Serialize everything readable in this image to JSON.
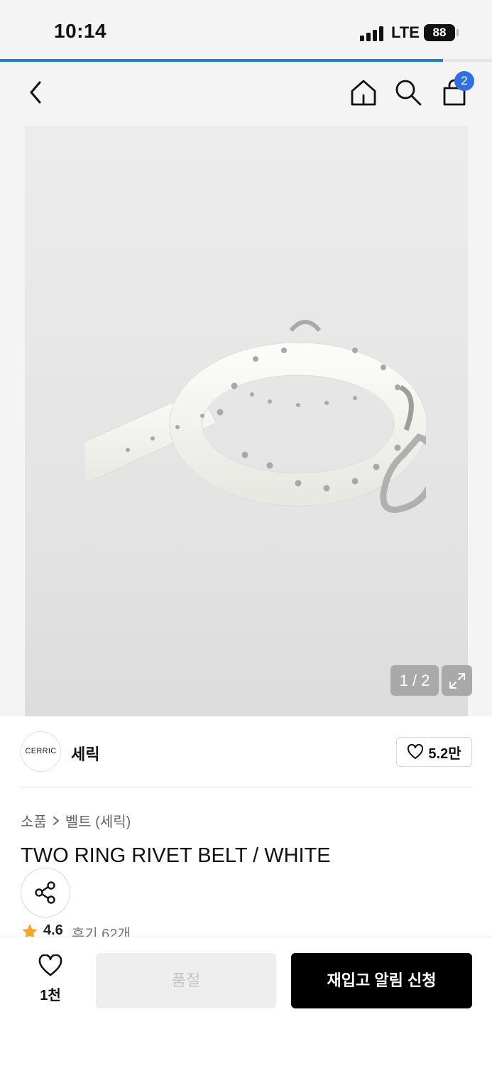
{
  "status_bar": {
    "time": "10:14",
    "network": "LTE",
    "battery": "88",
    "page_load_progress_pct": 90
  },
  "nav": {
    "cart_count": "2",
    "icons": [
      "chevron-left-icon",
      "home-icon",
      "search-icon",
      "shopping-bag-icon"
    ]
  },
  "gallery": {
    "counter": "1 / 2",
    "expand_icon": "expand-icon"
  },
  "brand": {
    "logo_text": "CERRIC",
    "name": "세릭",
    "likes": "5.2만"
  },
  "product": {
    "breadcrumb": [
      "소품",
      "벨트 (세릭)"
    ],
    "title": "TWO RING RIVET BELT / WHITE",
    "rating": "4.6",
    "reviews": "후기 62개"
  },
  "bottom_bar": {
    "wish_count": "1천",
    "soldout_label": "품절",
    "restock_label": "재입고 알림 신청"
  },
  "colors": {
    "accent_blue": "#2f6fe6",
    "progress_blue": "#1e7fd8",
    "star_orange": "#f5a623",
    "primary_button": "#000000"
  }
}
